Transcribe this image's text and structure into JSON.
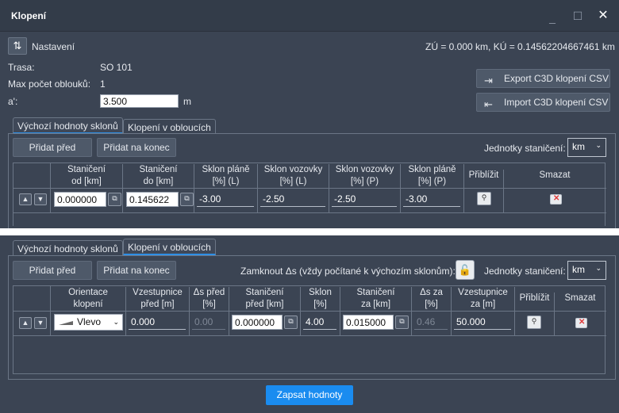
{
  "window": {
    "title": "Klopení",
    "minimize": "_",
    "maximize": "☐",
    "close": "✕"
  },
  "toolbar": {
    "settings_label": "Nastavení",
    "station_info": "ZÚ = 0.000 km, KÚ = 0.14562204667461 km"
  },
  "info": {
    "trasa_label": "Trasa:",
    "trasa_value": "SO 101",
    "max_label": "Max počet oblouků:",
    "max_value": "1",
    "a_label": "a':",
    "a_value": "3.500",
    "a_unit": "m"
  },
  "actions": {
    "export_label": "Export C3D klopení CSV",
    "import_label": "Import C3D klopení CSV"
  },
  "tabs": [
    "Výchozí hodnoty sklonů",
    "Klopení v obloucích"
  ],
  "grid1": {
    "add_before": "Přidat před",
    "add_end": "Přidat na konec",
    "units_label": "Jednotky staničení:",
    "units_value": "km",
    "headers": [
      [
        "Staničení",
        "od [km]"
      ],
      [
        "Staničení",
        "do [km]"
      ],
      [
        "Sklon pláně",
        "[%] (L)"
      ],
      [
        "Sklon vozovky",
        "[%] (L)"
      ],
      [
        "Sklon vozovky",
        "[%] (P)"
      ],
      [
        "Sklon pláně",
        "[%] (P)"
      ],
      [
        "Přiblížit",
        ""
      ],
      [
        "Smazat",
        ""
      ]
    ],
    "row": [
      "0.000000",
      "0.145622",
      "-3.00",
      "-2.50",
      "-2.50",
      "-3.00"
    ]
  },
  "grid2": {
    "add_before": "Přidat před",
    "add_end": "Přidat na konec",
    "lock_label": "Zamknout Δs (vždy počítané k výchozím sklonům):",
    "units_label": "Jednotky staničení:",
    "units_value": "km",
    "headers": [
      [
        "Orientace",
        "klopení"
      ],
      [
        "Vzestupnice",
        "před [m]"
      ],
      [
        "Δs před",
        "[%]"
      ],
      [
        "Staničení",
        "před [km]"
      ],
      [
        "Sklon",
        "[%]"
      ],
      [
        "Staničení",
        "za [km]"
      ],
      [
        "Δs za",
        "[%]"
      ],
      [
        "Vzestupnice",
        "za [m]"
      ],
      [
        "Přiblížit",
        ""
      ],
      [
        "Smazat",
        ""
      ]
    ],
    "row": {
      "orientation": "Vlevo",
      "vz_pred": "0.000",
      "ds_pred": "0.00",
      "st_pred": "0.000000",
      "sklon": "4.00",
      "st_za": "0.015000",
      "ds_za": "0.46",
      "vz_za": "50.000"
    }
  },
  "footer": {
    "submit_label": "Zapsat hodnoty"
  }
}
